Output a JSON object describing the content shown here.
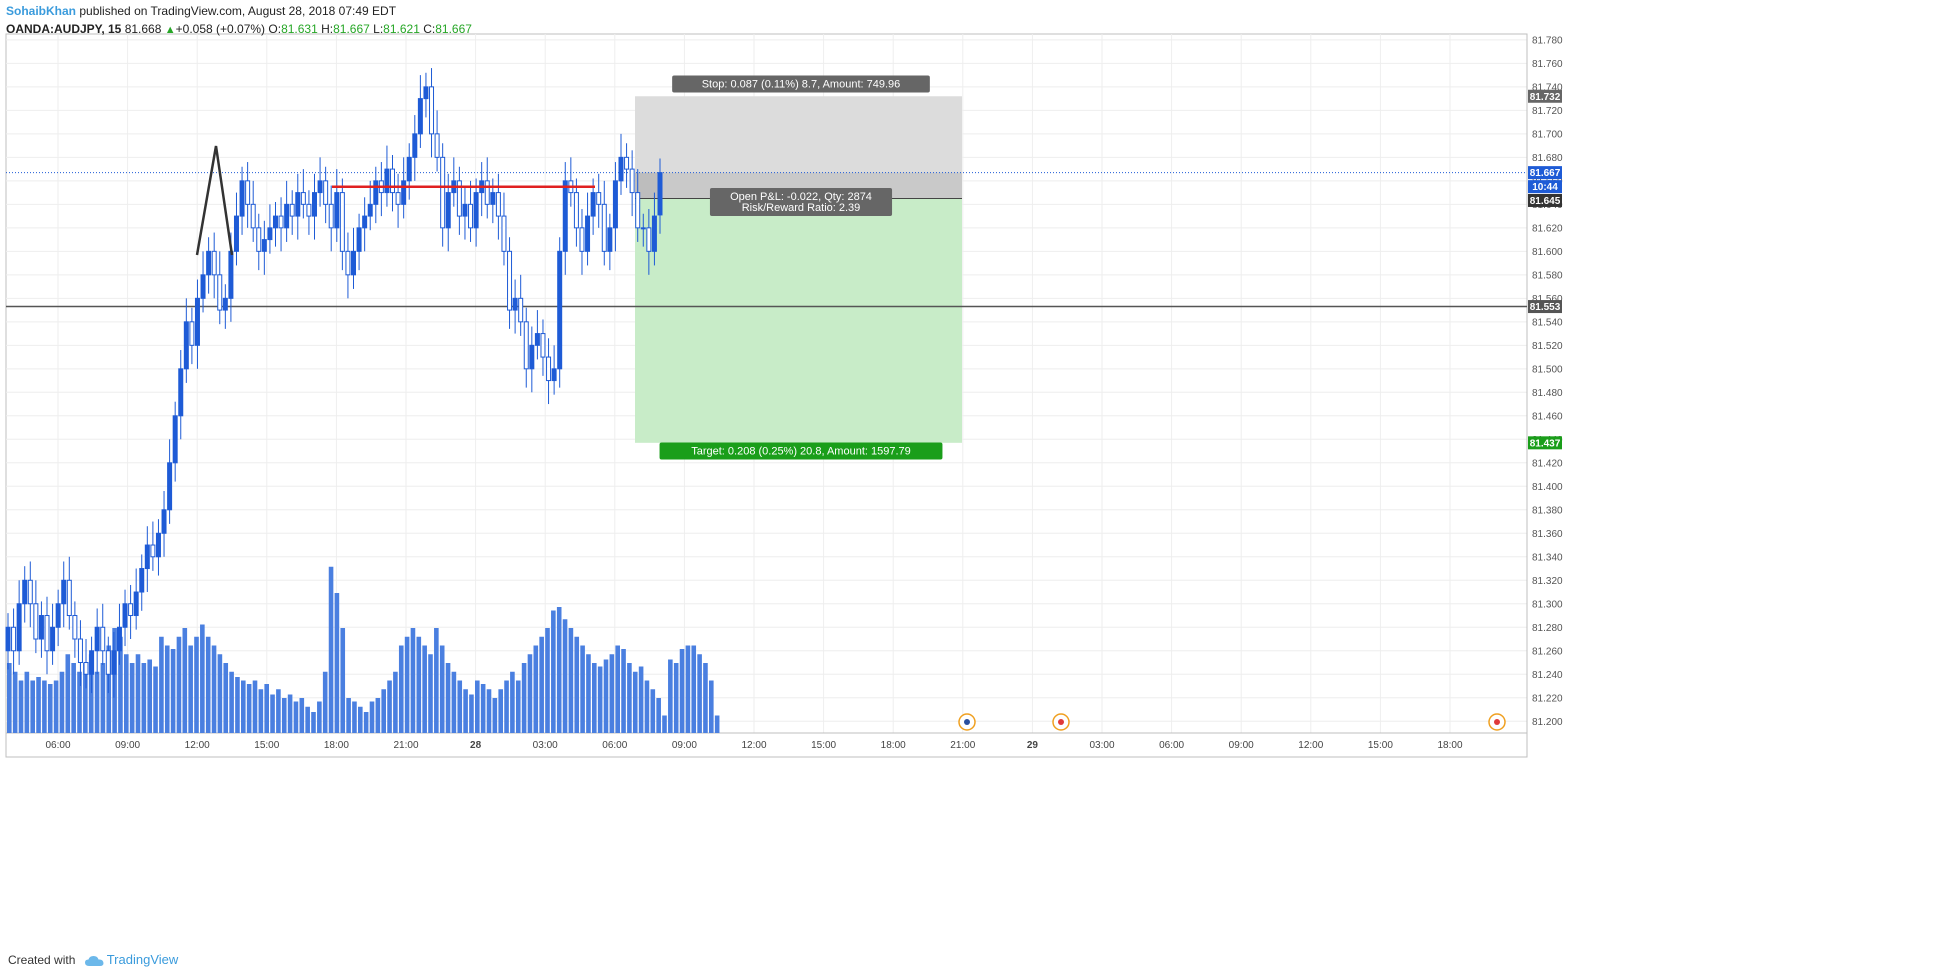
{
  "header": {
    "author": "SohaibKhan",
    "published_text": "published on TradingView.com, August 28, 2018 07:49 EDT",
    "symbol": "OANDA:AUDJPY, 15",
    "price": "81.668",
    "change": "+0.058 (+0.07%)",
    "o_label": "O:",
    "o_value": "81.631",
    "h_label": "H:",
    "h_value": "81.667",
    "l_label": "L:",
    "l_value": "81.621",
    "c_label": "C:",
    "c_value": "81.667"
  },
  "footer": {
    "created_with": "Created with",
    "brand": "TradingView"
  },
  "colors": {
    "bull": "#1e5bd6",
    "bear": "#1e5bd6",
    "volume": "#4a7fe0",
    "stop_zone": "#dcdcdc",
    "target_zone": "#c8ecc8",
    "target_badge": "#1a9e1a",
    "stop_badge": "#666666",
    "level_line": "#555555",
    "price_tag": "#1e5bd6",
    "resistance": "#e02020",
    "grid": "#eeeeee"
  },
  "chart_data": {
    "type": "candlestick",
    "symbol": "OANDA:AUDJPY",
    "interval": "15",
    "y_range": [
      81.19,
      81.785
    ],
    "y_ticks": [
      "81.780",
      "81.760",
      "81.740",
      "81.720",
      "81.700",
      "81.680",
      "81.660",
      "81.640",
      "81.620",
      "81.600",
      "81.580",
      "81.560",
      "81.540",
      "81.520",
      "81.500",
      "81.480",
      "81.460",
      "81.440",
      "81.420",
      "81.400",
      "81.380",
      "81.360",
      "81.340",
      "81.320",
      "81.300",
      "81.280",
      "81.260",
      "81.240",
      "81.220",
      "81.200"
    ],
    "x_ticks": [
      "06:00",
      "09:00",
      "12:00",
      "15:00",
      "18:00",
      "21:00",
      "28",
      "03:00",
      "06:00",
      "09:00",
      "12:00",
      "15:00",
      "18:00",
      "21:00",
      "29",
      "03:00",
      "06:00",
      "09:00",
      "12:00",
      "15:00",
      "18:00"
    ],
    "candles_close": [
      81.28,
      81.26,
      81.3,
      81.32,
      81.3,
      81.27,
      81.29,
      81.26,
      81.28,
      81.3,
      81.32,
      81.29,
      81.27,
      81.25,
      81.24,
      81.26,
      81.28,
      81.26,
      81.24,
      81.26,
      81.28,
      81.3,
      81.29,
      81.31,
      81.33,
      81.35,
      81.34,
      81.36,
      81.38,
      81.42,
      81.46,
      81.5,
      81.54,
      81.52,
      81.56,
      81.58,
      81.6,
      81.58,
      81.55,
      81.56,
      81.6,
      81.63,
      81.66,
      81.64,
      81.62,
      81.6,
      81.61,
      81.62,
      81.63,
      81.62,
      81.64,
      81.63,
      81.65,
      81.64,
      81.63,
      81.65,
      81.66,
      81.64,
      81.62,
      81.65,
      81.6,
      81.58,
      81.6,
      81.62,
      81.63,
      81.64,
      81.66,
      81.65,
      81.67,
      81.65,
      81.64,
      81.66,
      81.68,
      81.7,
      81.73,
      81.74,
      81.7,
      81.68,
      81.62,
      81.65,
      81.66,
      81.63,
      81.64,
      81.62,
      81.65,
      81.66,
      81.64,
      81.65,
      81.63,
      81.6,
      81.55,
      81.56,
      81.54,
      81.5,
      81.52,
      81.53,
      81.51,
      81.49,
      81.5,
      81.6,
      81.66,
      81.65,
      81.62,
      81.6,
      81.63,
      81.65,
      81.64,
      81.6,
      81.62,
      81.66,
      81.68,
      81.67,
      81.65,
      81.62,
      81.62,
      81.6,
      81.63,
      81.667
    ],
    "candles_open": [
      81.26,
      81.28,
      81.26,
      81.3,
      81.32,
      81.3,
      81.27,
      81.29,
      81.26,
      81.28,
      81.3,
      81.32,
      81.29,
      81.27,
      81.25,
      81.24,
      81.26,
      81.28,
      81.26,
      81.24,
      81.26,
      81.28,
      81.3,
      81.29,
      81.31,
      81.33,
      81.35,
      81.34,
      81.36,
      81.38,
      81.42,
      81.46,
      81.5,
      81.54,
      81.52,
      81.56,
      81.58,
      81.6,
      81.58,
      81.55,
      81.56,
      81.6,
      81.63,
      81.66,
      81.64,
      81.62,
      81.6,
      81.61,
      81.62,
      81.63,
      81.62,
      81.64,
      81.63,
      81.65,
      81.64,
      81.63,
      81.65,
      81.66,
      81.64,
      81.62,
      81.65,
      81.6,
      81.58,
      81.6,
      81.62,
      81.63,
      81.64,
      81.66,
      81.65,
      81.67,
      81.65,
      81.64,
      81.66,
      81.68,
      81.7,
      81.73,
      81.74,
      81.7,
      81.68,
      81.62,
      81.65,
      81.66,
      81.63,
      81.64,
      81.62,
      81.65,
      81.66,
      81.64,
      81.65,
      81.63,
      81.6,
      81.55,
      81.56,
      81.54,
      81.5,
      81.52,
      81.53,
      81.51,
      81.49,
      81.5,
      81.6,
      81.66,
      81.65,
      81.62,
      81.6,
      81.63,
      81.65,
      81.64,
      81.6,
      81.62,
      81.66,
      81.68,
      81.67,
      81.65,
      81.62,
      81.62,
      81.6,
      81.631
    ],
    "volume_rel": [
      0.4,
      0.35,
      0.3,
      0.35,
      0.3,
      0.32,
      0.3,
      0.28,
      0.3,
      0.35,
      0.45,
      0.4,
      0.35,
      0.4,
      0.45,
      0.35,
      0.4,
      0.5,
      0.6,
      0.55,
      0.45,
      0.4,
      0.45,
      0.4,
      0.42,
      0.38,
      0.55,
      0.5,
      0.48,
      0.55,
      0.6,
      0.5,
      0.55,
      0.62,
      0.55,
      0.5,
      0.45,
      0.4,
      0.35,
      0.32,
      0.3,
      0.28,
      0.3,
      0.25,
      0.28,
      0.22,
      0.25,
      0.2,
      0.22,
      0.18,
      0.2,
      0.15,
      0.12,
      0.18,
      0.35,
      0.95,
      0.8,
      0.6,
      0.2,
      0.18,
      0.15,
      0.12,
      0.18,
      0.2,
      0.25,
      0.3,
      0.35,
      0.5,
      0.55,
      0.6,
      0.55,
      0.5,
      0.45,
      0.6,
      0.5,
      0.4,
      0.35,
      0.3,
      0.25,
      0.22,
      0.3,
      0.28,
      0.25,
      0.2,
      0.25,
      0.3,
      0.35,
      0.3,
      0.4,
      0.45,
      0.5,
      0.55,
      0.6,
      0.7,
      0.72,
      0.65,
      0.6,
      0.55,
      0.5,
      0.45,
      0.4,
      0.38,
      0.42,
      0.45,
      0.5,
      0.48,
      0.4,
      0.35,
      0.38,
      0.3,
      0.25,
      0.2,
      0.1
    ],
    "volume_rel_tail": [
      0.42,
      0.4,
      0.48,
      0.5,
      0.5,
      0.45,
      0.4,
      0.3,
      0.1
    ],
    "levels": {
      "last_price": "81.667",
      "entry": "81.645",
      "stop": "81.732",
      "target": "81.437",
      "support": "81.553",
      "timer": "10:44"
    },
    "resistance_level": 81.655,
    "position": {
      "type": "short",
      "stop_label": "Stop: 0.087 (0.11%) 8.7, Amount: 749.96",
      "pnl_label": "Open P&L: -0.022, Qty: 2874",
      "rr_label": "Risk/Reward Ratio: 2.39",
      "target_label": "Target: 0.208 (0.25%) 20.8, Amount: 1597.79"
    },
    "grid": true
  }
}
